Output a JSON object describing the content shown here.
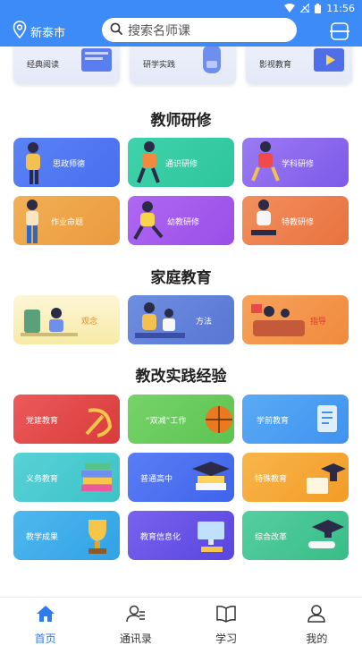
{
  "status_bar": {
    "time": "11:56"
  },
  "header": {
    "city": "新泰市",
    "search_placeholder": "搜索名师课",
    "location_icon": "location-pin-icon",
    "scan_icon": "scan-icon"
  },
  "top_row": [
    {
      "label": "经典阅读"
    },
    {
      "label": "研学实践"
    },
    {
      "label": "影视教育"
    }
  ],
  "sections": [
    {
      "title": "教师研修",
      "cards": [
        {
          "label": "思政师德"
        },
        {
          "label": "通识研修"
        },
        {
          "label": "学科研修"
        },
        {
          "label": "作业命题"
        },
        {
          "label": "幼教研修"
        },
        {
          "label": "特教研修"
        }
      ]
    },
    {
      "title": "家庭教育",
      "cards": [
        {
          "label": "观念"
        },
        {
          "label": "方法"
        },
        {
          "label": "指导"
        }
      ]
    },
    {
      "title": "教改实践经验",
      "cards": [
        {
          "label": "党建教育"
        },
        {
          "label": "“双减”工作"
        },
        {
          "label": "学前教育"
        },
        {
          "label": "义务教育"
        },
        {
          "label": "普通高中"
        },
        {
          "label": "特殊教育"
        },
        {
          "label": "教学成果"
        },
        {
          "label": "教育信息化"
        },
        {
          "label": "综合改革"
        }
      ]
    }
  ],
  "tabs": [
    {
      "label": "首页",
      "icon": "home-icon",
      "active": true
    },
    {
      "label": "通讯录",
      "icon": "contacts-icon",
      "active": false
    },
    {
      "label": "学习",
      "icon": "book-icon",
      "active": false
    },
    {
      "label": "我的",
      "icon": "profile-icon",
      "active": false
    }
  ],
  "colors": {
    "primary": "#3d8bf6",
    "active_tab": "#2f7bf0"
  }
}
